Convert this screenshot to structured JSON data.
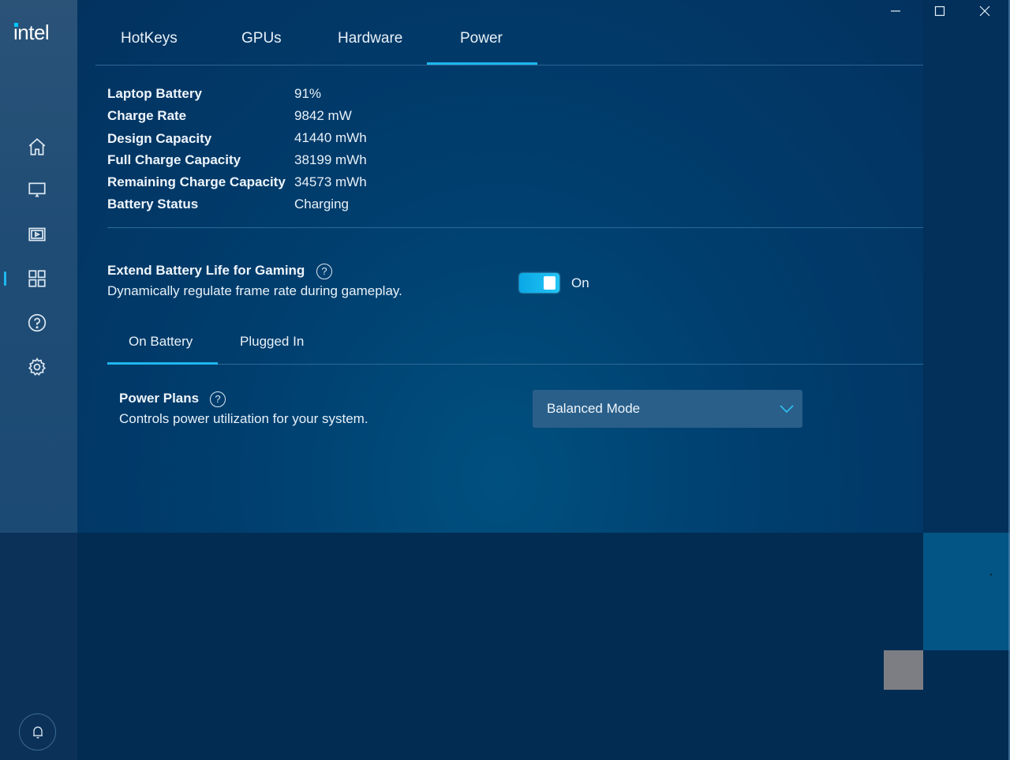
{
  "app": {
    "logo_text": "intel"
  },
  "window_controls": {
    "minimize_icon": "minimize-icon",
    "maximize_icon": "maximize-icon",
    "close_icon": "close-icon"
  },
  "sidebar": {
    "items": [
      {
        "name": "home",
        "icon": "home-icon",
        "active": false
      },
      {
        "name": "display",
        "icon": "monitor-icon",
        "active": false
      },
      {
        "name": "video",
        "icon": "video-icon",
        "active": false
      },
      {
        "name": "system",
        "icon": "grid-icon",
        "active": true
      },
      {
        "name": "help",
        "icon": "help-icon",
        "active": false
      },
      {
        "name": "settings",
        "icon": "gear-icon",
        "active": false
      }
    ],
    "notifications_icon": "bell-icon"
  },
  "tabs": [
    {
      "label": "HotKeys",
      "active": false
    },
    {
      "label": "GPUs",
      "active": false
    },
    {
      "label": "Hardware",
      "active": false
    },
    {
      "label": "Power",
      "active": true
    }
  ],
  "battery_info": [
    {
      "label": "Laptop Battery",
      "value": "91%"
    },
    {
      "label": "Charge Rate",
      "value": "9842 mW"
    },
    {
      "label": "Design Capacity",
      "value": "41440 mWh"
    },
    {
      "label": "Full Charge Capacity",
      "value": "38199 mWh"
    },
    {
      "label": "Remaining Charge Capacity",
      "value": "34573 mWh"
    },
    {
      "label": "Battery Status",
      "value": "Charging"
    }
  ],
  "extend_battery": {
    "title": "Extend Battery Life for Gaming",
    "description": "Dynamically regulate frame rate during gameplay.",
    "help_glyph": "?",
    "toggle_on": true,
    "toggle_label": "On"
  },
  "power_tabs": [
    {
      "label": "On Battery",
      "active": true
    },
    {
      "label": "Plugged In",
      "active": false
    }
  ],
  "power_plans": {
    "title": "Power Plans",
    "description": "Controls power utilization for your system.",
    "help_glyph": "?",
    "selected": "Balanced Mode"
  },
  "colors": {
    "accent": "#1eb7ef",
    "background": "#003e6e",
    "sidebar": "#1f4c75"
  }
}
